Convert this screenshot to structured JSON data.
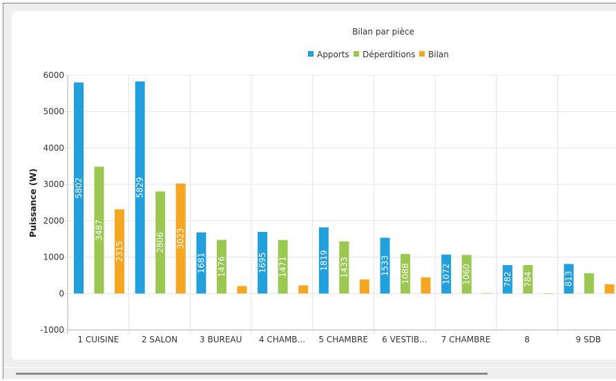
{
  "chart_data": {
    "type": "bar",
    "title": "Bilan par pièce",
    "xlabel": "",
    "ylabel": "Puissance (W)",
    "ylim": [
      -1000,
      6000
    ],
    "yticks": [
      -1000,
      0,
      1000,
      2000,
      3000,
      4000,
      5000,
      6000
    ],
    "grid": true,
    "legend_position": "top-center",
    "categories": [
      "1 CUISINE",
      "2 SALON",
      "3 BUREAU",
      "4 CHAMB...",
      "5 CHAMBRE",
      "6 VESTIB...",
      "7 CHAMBRE",
      "8",
      "9 SDB"
    ],
    "series": [
      {
        "name": "Apports",
        "color": "#229fdd",
        "values": [
          5802,
          5829,
          1681,
          1695,
          1819,
          1533,
          1072,
          782,
          813
        ]
      },
      {
        "name": "Déperditions",
        "color": "#9bc850",
        "values": [
          3487,
          2806,
          1476,
          1471,
          1433,
          1088,
          1060,
          784,
          559
        ]
      },
      {
        "name": "Bilan",
        "color": "#f5a623",
        "values": [
          2315,
          3023,
          205,
          224,
          387,
          446,
          12,
          -2,
          254
        ]
      }
    ]
  }
}
